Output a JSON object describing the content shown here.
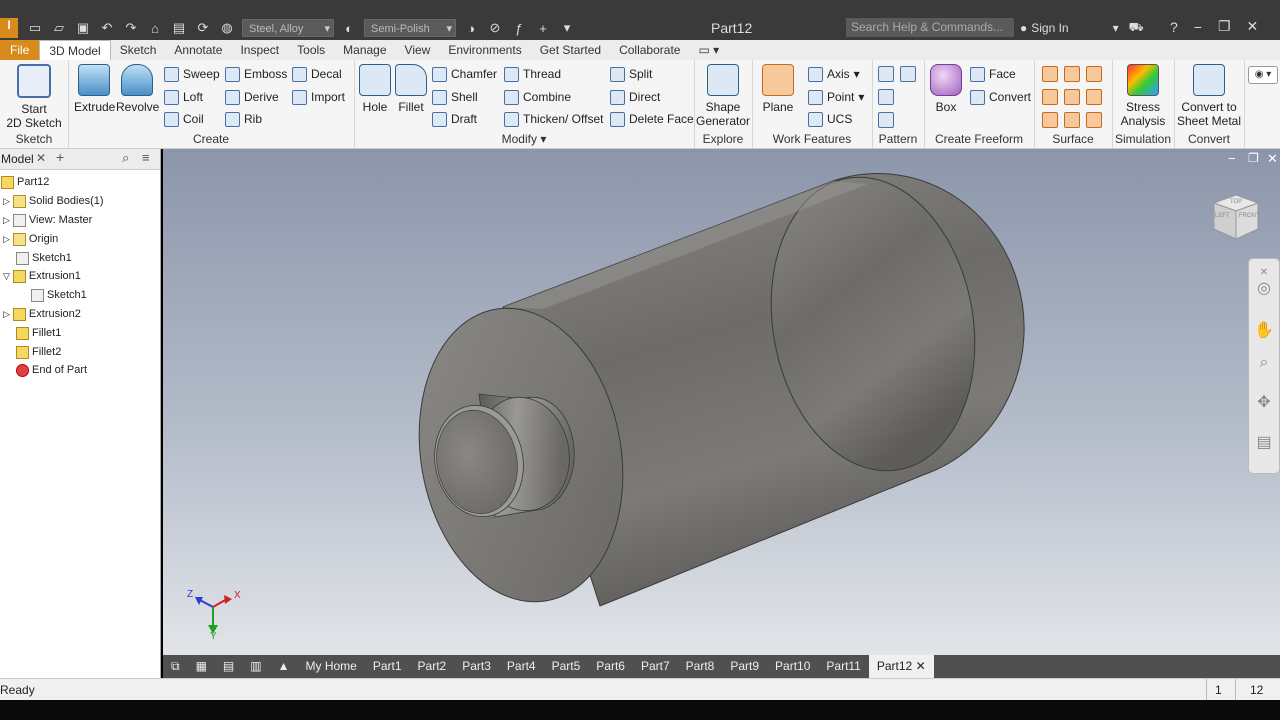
{
  "app": {
    "document_title": "Part12",
    "material": "Steel, Alloy",
    "appearance": "Semi-Polish",
    "search_placeholder": "Search Help & Commands...",
    "sign_in": "Sign In",
    "app_badge": "I",
    "help": "?"
  },
  "tabs": [
    "File",
    "3D Model",
    "Sketch",
    "Annotate",
    "Inspect",
    "Tools",
    "Manage",
    "View",
    "Environments",
    "Get Started",
    "Collaborate"
  ],
  "ribbon": {
    "sketch": {
      "label": "Sketch",
      "start_line1": "Start",
      "start_line2": "2D Sketch"
    },
    "create": {
      "label": "Create",
      "extrude": "Extrude",
      "revolve": "Revolve",
      "sweep": "Sweep",
      "loft": "Loft",
      "coil": "Coil",
      "emboss": "Emboss",
      "derive": "Derive",
      "rib": "Rib",
      "decal": "Decal",
      "import": "Import"
    },
    "modify": {
      "label": "Modify",
      "hole": "Hole",
      "fillet": "Fillet",
      "chamfer": "Chamfer",
      "shell": "Shell",
      "draft": "Draft",
      "thread": "Thread",
      "combine": "Combine",
      "thicken": "Thicken/ Offset",
      "split": "Split",
      "direct": "Direct",
      "delete_face": "Delete Face"
    },
    "explore": {
      "label": "Explore",
      "shape_line1": "Shape",
      "shape_line2": "Generator"
    },
    "work": {
      "label": "Work Features",
      "plane": "Plane",
      "axis": "Axis",
      "point": "Point",
      "ucs": "UCS"
    },
    "pattern": {
      "label": "Pattern"
    },
    "freeform": {
      "label": "Create Freeform",
      "box": "Box",
      "face": "Face",
      "convert": "Convert"
    },
    "surface": {
      "label": "Surface"
    },
    "simulation": {
      "label": "Simulation",
      "stress_line1": "Stress",
      "stress_line2": "Analysis"
    },
    "convert": {
      "label": "Convert",
      "sheet_line1": "Convert to",
      "sheet_line2": "Sheet Metal"
    }
  },
  "browser": {
    "title": "Model",
    "items": [
      {
        "label": "Part12"
      },
      {
        "label": "Solid Bodies(1)"
      },
      {
        "label": "View: Master"
      },
      {
        "label": "Origin"
      },
      {
        "label": "Sketch1"
      },
      {
        "label": "Extrusion1"
      },
      {
        "label": "Sketch1"
      },
      {
        "label": "Extrusion2"
      },
      {
        "label": "Fillet1"
      },
      {
        "label": "Fillet2"
      },
      {
        "label": "End of Part"
      }
    ]
  },
  "viewcube": {
    "left": "LEFT",
    "front": "FRONT",
    "top": "TOP"
  },
  "triad": {
    "x": "X",
    "y": "Y",
    "z": "Z"
  },
  "doc_tabs": [
    "My Home",
    "Part1",
    "Part2",
    "Part3",
    "Part4",
    "Part5",
    "Part6",
    "Part7",
    "Part8",
    "Part9",
    "Part10",
    "Part11",
    "Part12"
  ],
  "status": {
    "text": "Ready",
    "num1": "1",
    "num2": "12"
  }
}
